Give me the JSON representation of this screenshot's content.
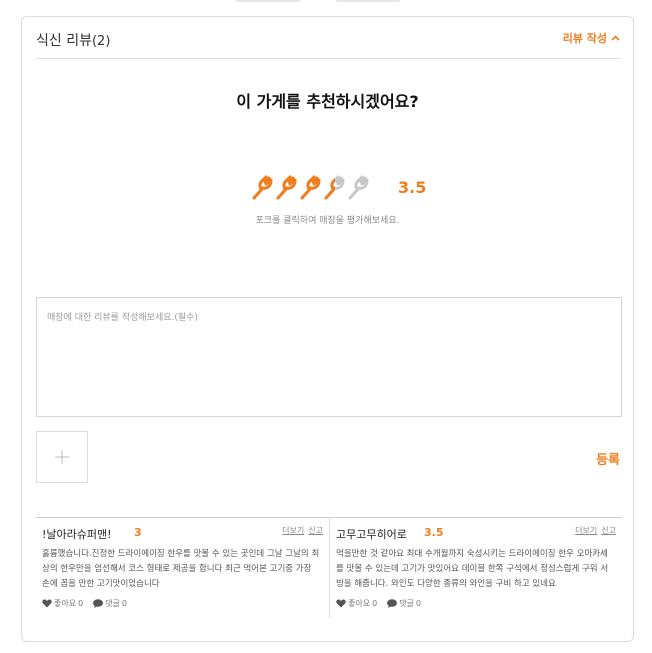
{
  "section": {
    "title": "식신 리뷰",
    "count": "(2)",
    "write_label": "리뷰 작성"
  },
  "question": "이 가게를 추천하시겠어요?",
  "rating": {
    "score": "3.5",
    "value": 3.5,
    "max": 5,
    "hint": "포크를 클릭하여 매장을 평가해보세요.",
    "active_color": "#f07e1e",
    "inactive_color": "#c8c8c8"
  },
  "review_input": {
    "placeholder": "매장에 대한 리뷰를 작성해보세요.(필수)"
  },
  "submit_label": "등록",
  "reviews": [
    {
      "name": "!날아라슈퍼맨!",
      "score": "3",
      "more": "더보기",
      "report": "신고",
      "body": "훌륭했습니다.진정한 드라이에이징 한우를 맛볼 수 있는 곳인데 그날 그날의 최상의 한우만을 엄선해서 코스 형태로 제공을 합니다 최근 먹어본 고기중 가장 손에 꼽을 만한 고기맛이었습니다",
      "like_label": "좋아요",
      "like_count": "0",
      "comment_label": "댓글",
      "comment_count": "0"
    },
    {
      "name": "고무고무히어로",
      "score": "3.5",
      "more": "더보기",
      "report": "신고",
      "body": "먹을만한 것 같아요 최대 수개월까지 숙성시키는 드라이에이징 한우 오마카세를 맛볼 수 있는데 고기가 맛있어요 데이블 한쪽 구석에서 정성스럽게 구워 서빙을 해줍니다. 와인도 다양한 종류의 와인을 구비 하고 있네요",
      "like_label": "좋아요",
      "like_count": "0",
      "comment_label": "댓글",
      "comment_count": "0"
    }
  ]
}
